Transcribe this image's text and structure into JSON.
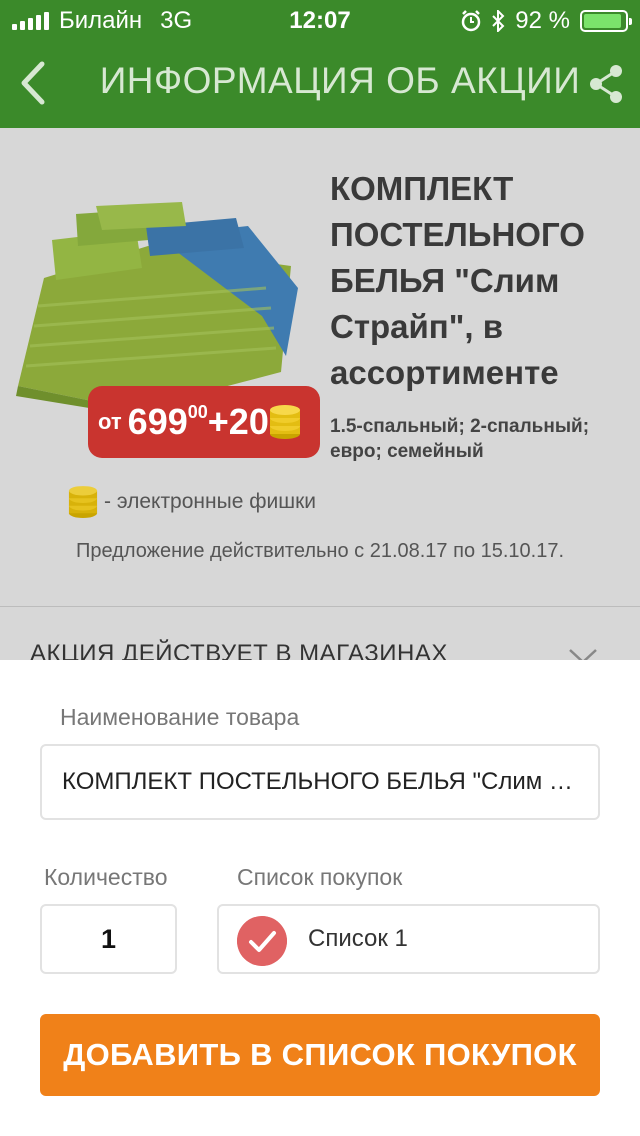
{
  "status_bar": {
    "carrier": "Билайн",
    "network": "3G",
    "time": "12:07",
    "battery_percent": "92 %",
    "battery_level": 0.92,
    "icons": [
      "signal-icon",
      "alarm-icon",
      "bluetooth-icon",
      "battery-icon"
    ]
  },
  "nav": {
    "title": "ИНФОРМАЦИЯ ОБ АКЦИИ",
    "back_icon": "chevron-left-icon",
    "share_icon": "share-icon",
    "bar_color": "#3b8a2a"
  },
  "product": {
    "title": "КОМПЛЕКТ ПОСТЕЛЬНОГО БЕЛЬЯ \"Слим Страйп\", в ассортименте",
    "variants": "1.5-спальный; 2-спальный; евро; семейный",
    "price_prefix": "от",
    "price_main": "699",
    "price_cents": "00",
    "price_plus": "+20",
    "chips_legend": "- электронные фишки",
    "offer_period": "Предложение действительно с 21.08.17 по 15.10.17.",
    "badge_color": "#c9342f"
  },
  "stores": {
    "title": "АКЦИЯ ДЕЙСТВУЕТ В МАГАЗИНАХ",
    "icon": "chevron-down-icon"
  },
  "form": {
    "name_label": "Наименование товара",
    "name_value": "КОМПЛЕКТ ПОСТЕЛЬНОГО БЕЛЬЯ \"Слим Страйп\", в ассортименте",
    "quantity_label": "Количество",
    "quantity_value": "1",
    "list_label": "Список покупок",
    "list_value": "Список 1",
    "list_icon": "checkmark-circle-icon",
    "list_icon_color": "#e06263",
    "add_button": "ДОБАВИТЬ В СПИСОК ПОКУПОК",
    "button_color": "#f08119"
  }
}
